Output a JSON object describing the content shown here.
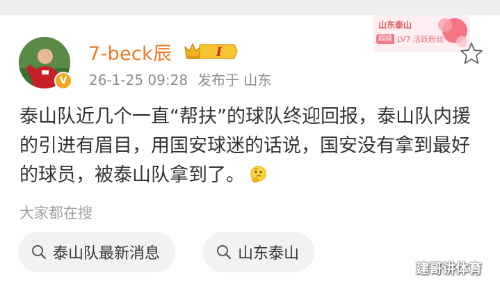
{
  "post": {
    "username": "7-beck辰",
    "level_badge": "I",
    "date": "26-1-25 09:28",
    "location": "发布于 山东",
    "text": "泰山队近几个一直“帮扶”的球队终迎回报，泰山队内援的引进有眉目，用国安球迷的话说，国安没有拿到最好的球员，被泰山队拿到了。",
    "verified_badge": "V"
  },
  "fan_badge": {
    "team": "山东泰山",
    "tag": "超级",
    "level": "LV7 活跃粉丝"
  },
  "search_section": {
    "title": "大家都在搜",
    "chips": [
      {
        "label": "泰山队最新消息"
      },
      {
        "label": "山东泰山"
      }
    ]
  },
  "watermark": "建哥讲体育",
  "colors": {
    "username": "#f0791f",
    "meta": "#8c8c8c",
    "chip_bg": "#f2f2f2"
  }
}
